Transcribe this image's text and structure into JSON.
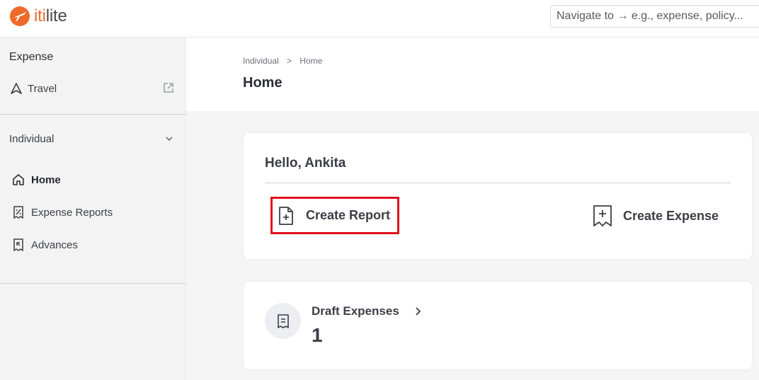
{
  "brand": {
    "name_prefix": "iti",
    "name_suffix": "lite",
    "accent_color": "#ef6a2a",
    "logo_icon": "plane-logo-icon"
  },
  "search": {
    "placeholder": "Navigate to → e.g., expense, policy..."
  },
  "sidebar": {
    "heading": "Expense",
    "travel_label": "Travel",
    "section_label": "Individual",
    "items": [
      {
        "label": "Home",
        "icon": "home-icon",
        "active": true
      },
      {
        "label": "Expense Reports",
        "icon": "receipt-percent-icon",
        "active": false
      },
      {
        "label": "Advances",
        "icon": "advance-icon",
        "active": false
      }
    ]
  },
  "header": {
    "breadcrumb": [
      "Individual",
      ">",
      "Home"
    ],
    "title": "Home"
  },
  "main": {
    "greeting": "Hello, Ankita",
    "create_report_label": "Create Report",
    "create_expense_label": "Create Expense",
    "highlight_color": "#e0101d",
    "draft": {
      "label": "Draft Expenses",
      "count": "1"
    }
  }
}
